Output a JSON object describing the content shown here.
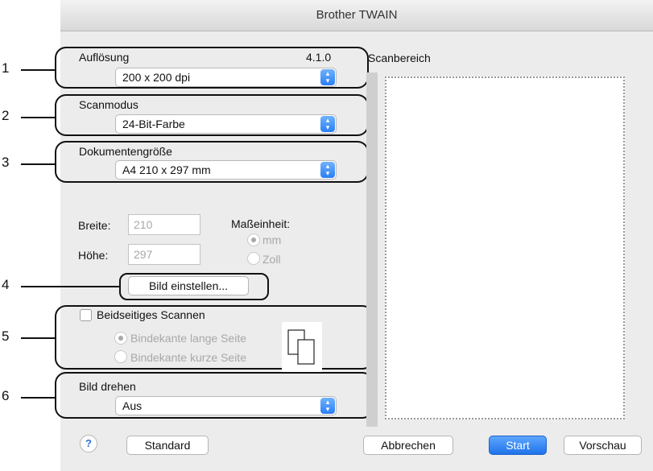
{
  "window": {
    "title": "Brother TWAIN"
  },
  "callouts": [
    "1",
    "2",
    "3",
    "4",
    "5",
    "6"
  ],
  "resolution": {
    "label": "Auflösung",
    "version": "4.1.0",
    "value": "200 x 200 dpi"
  },
  "scan_mode": {
    "label": "Scanmodus",
    "value": "24-Bit-Farbe"
  },
  "doc_size": {
    "label": "Dokumentengröße",
    "value": "A4  210 x 297 mm"
  },
  "dimensions": {
    "width_label": "Breite:",
    "width_value": "210",
    "height_label": "Höhe:",
    "height_value": "297",
    "unit_label": "Maßeinheit:",
    "unit_options": [
      "mm",
      "Zoll"
    ],
    "unit_selected": "mm"
  },
  "adjust_button": "Bild einstellen...",
  "duplex": {
    "label": "Beidseitiges Scannen",
    "checked": false,
    "options": [
      "Bindekante lange Seite",
      "Bindekante kurze Seite"
    ],
    "selected": "Bindekante lange Seite"
  },
  "rotate": {
    "label": "Bild drehen",
    "value": "Aus"
  },
  "scan_area": {
    "label": "Scanbereich"
  },
  "buttons": {
    "help": "?",
    "default": "Standard",
    "cancel": "Abbrechen",
    "start": "Start",
    "preview": "Vorschau"
  },
  "icons": {
    "help": "help-icon",
    "popup": "updown-chevron-icon",
    "duplex": "document-pages-icon"
  }
}
